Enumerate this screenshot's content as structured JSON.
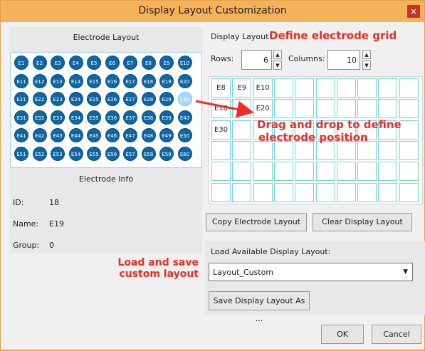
{
  "window": {
    "title": "Display Layout Customization",
    "close_glyph": "×"
  },
  "left": {
    "electrode_layout_heading": "Electrode Layout",
    "electrodes": [
      "E1",
      "E2",
      "E3",
      "E4",
      "E5",
      "E6",
      "E7",
      "E8",
      "E9",
      "E10",
      "E11",
      "E12",
      "E13",
      "E14",
      "E15",
      "E16",
      "E17",
      "E18",
      "E19",
      "E20",
      "E21",
      "E22",
      "E23",
      "E24",
      "E25",
      "E26",
      "E27",
      "E28",
      "E29",
      "E30",
      "E31",
      "E32",
      "E33",
      "E34",
      "E35",
      "E36",
      "E37",
      "E38",
      "E39",
      "E40",
      "E41",
      "E42",
      "E43",
      "E44",
      "E45",
      "E46",
      "E47",
      "E48",
      "E49",
      "E50",
      "E51",
      "E52",
      "E53",
      "E54",
      "E55",
      "E56",
      "E57",
      "E58",
      "E59",
      "E60"
    ],
    "selected_electrode": "E30",
    "electrode_info_heading": "Electrode Info",
    "info": {
      "id_label": "ID:",
      "id_value": "18",
      "name_label": "Name:",
      "name_value": "E19",
      "group_label": "Group:",
      "group_value": "0"
    }
  },
  "right": {
    "display_layout_label": "Display Layout",
    "rows_label": "Rows:",
    "rows_value": "6",
    "columns_label": "Columns:",
    "columns_value": "10",
    "grid_cells": [
      [
        "E8",
        "E9",
        "E10",
        "",
        "",
        "",
        "",
        "",
        "",
        ""
      ],
      [
        "E18",
        "E",
        "E20",
        "",
        "",
        "",
        "",
        "",
        "",
        ""
      ],
      [
        "E30",
        "",
        "",
        "",
        "",
        "",
        "",
        "",
        "",
        ""
      ],
      [
        "",
        "",
        "",
        "",
        "",
        "",
        "",
        "",
        "",
        ""
      ],
      [
        "",
        "",
        "",
        "",
        "",
        "",
        "",
        "",
        "",
        ""
      ],
      [
        "",
        "",
        "",
        "",
        "",
        "",
        "",
        "",
        "",
        ""
      ]
    ],
    "copy_button": "Copy Electrode Layout",
    "clear_button": "Clear Display Layout",
    "load_label": "Load Available Display Layout:",
    "selected_layout": "Layout_Custom",
    "save_button": "Save Display Layout As ...",
    "ok_button": "OK",
    "cancel_button": "Cancel"
  },
  "annotations": {
    "define_grid": "Define electrode grid",
    "drag_line1": "Drag and drop to define",
    "drag_line2": "electrode position",
    "load_line1": "Load and save",
    "load_line2": "custom layout",
    "arrow_color": "#ef2b24"
  },
  "icons": {
    "spin_up": "▲",
    "spin_down": "▼",
    "dropdown": "▼"
  }
}
